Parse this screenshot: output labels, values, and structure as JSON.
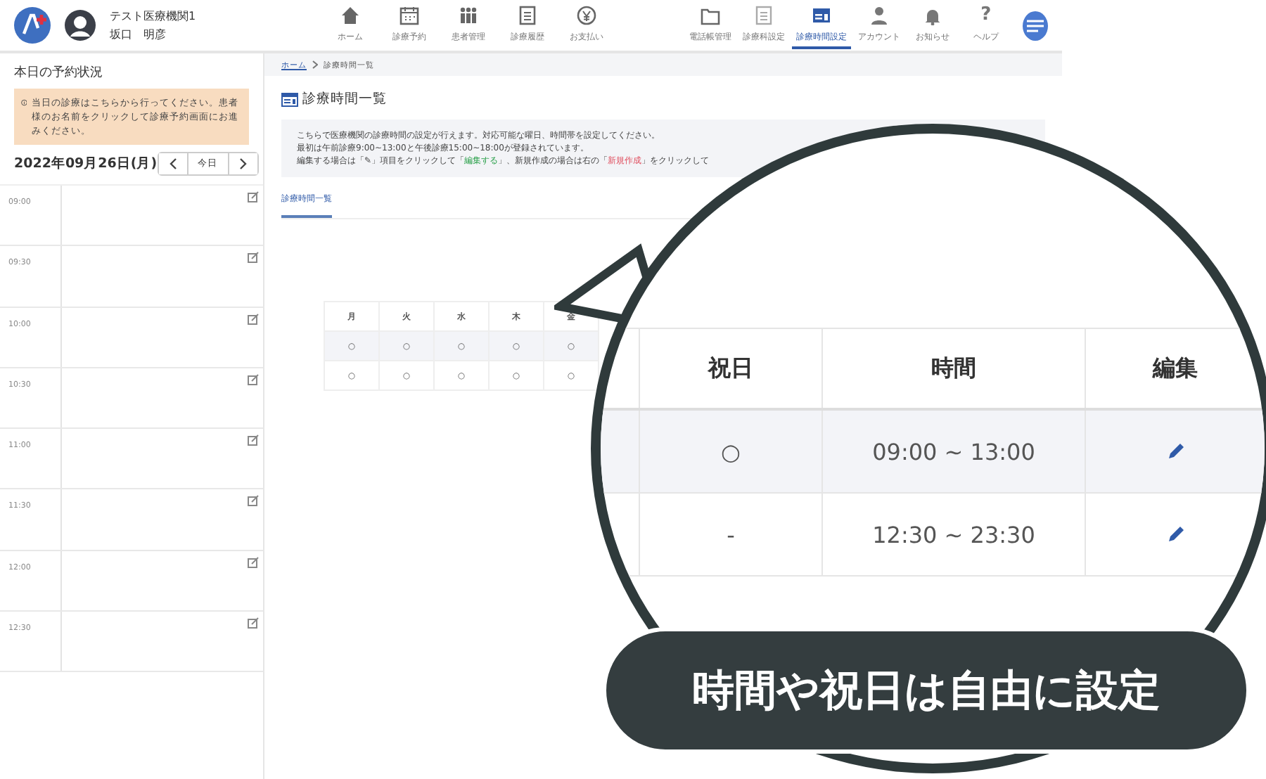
{
  "header": {
    "org_name": "テスト医療機関1",
    "user_name": "坂口　明彦",
    "nav": [
      {
        "label": "ホーム",
        "selected": false
      },
      {
        "label": "診療予約",
        "selected": false
      },
      {
        "label": "患者管理",
        "selected": false
      },
      {
        "label": "診療履歴",
        "selected": false
      },
      {
        "label": "お支払い",
        "selected": false
      }
    ],
    "right_nav": [
      {
        "label": "電話帳管理",
        "selected": false
      },
      {
        "label": "診療科設定",
        "selected": false
      },
      {
        "label": "診療時間設定",
        "selected": true
      },
      {
        "label": "アカウント",
        "selected": false
      },
      {
        "label": "お知らせ",
        "selected": false
      },
      {
        "label": "ヘルプ",
        "selected": false,
        "glyph": "?"
      }
    ]
  },
  "sidebar": {
    "title": "本日の予約状況",
    "notice": "当日の診療はこちらから行ってください。患者様のお名前をクリックして診療予約画面にお進みください。",
    "date": "2022年09月26日(月)",
    "today_button": "今日",
    "slots": [
      "09:00",
      "09:30",
      "10:00",
      "10:30",
      "11:00",
      "11:30",
      "12:00",
      "12:30"
    ]
  },
  "breadcrumb": {
    "home": "ホーム",
    "current": "診療時間一覧"
  },
  "page_title": "診療時間一覧",
  "description": {
    "lines": [
      "こちらで医療機関の診療時間の設定が行えます。対応可能な曜日、時間帯を設定してください。",
      "最初は午前診療9:00~13:00と午後診療15:00~18:00が登録されています。"
    ],
    "last_line": [
      {
        "kind": "plain",
        "text": "編集する場合は「✎」項目をクリックして「"
      },
      {
        "kind": "edit",
        "text": "編集する"
      },
      {
        "kind": "plain",
        "text": "」、新規作成の場合は右の「"
      },
      {
        "kind": "new",
        "text": "新規作成"
      },
      {
        "kind": "plain",
        "text": "」をクリックして"
      }
    ]
  },
  "tabs": [
    {
      "label": "診療時間一覧",
      "selected": true
    }
  ],
  "hours_table": {
    "columns": [
      "月",
      "火",
      "水",
      "木",
      "金"
    ],
    "rows": [
      [
        "○",
        "○",
        "○",
        "○",
        "○"
      ],
      [
        "○",
        "○",
        "○",
        "○",
        "○"
      ]
    ]
  },
  "zoom_bubble": {
    "columns": [
      "祝日",
      "時間",
      "編集"
    ],
    "rows": [
      {
        "holiday": "○",
        "time": "09:00 ~ 13:00"
      },
      {
        "holiday": "-",
        "time": "12:30 ~ 23:30"
      }
    ]
  },
  "caption": "時間や祝日は自由に設定"
}
